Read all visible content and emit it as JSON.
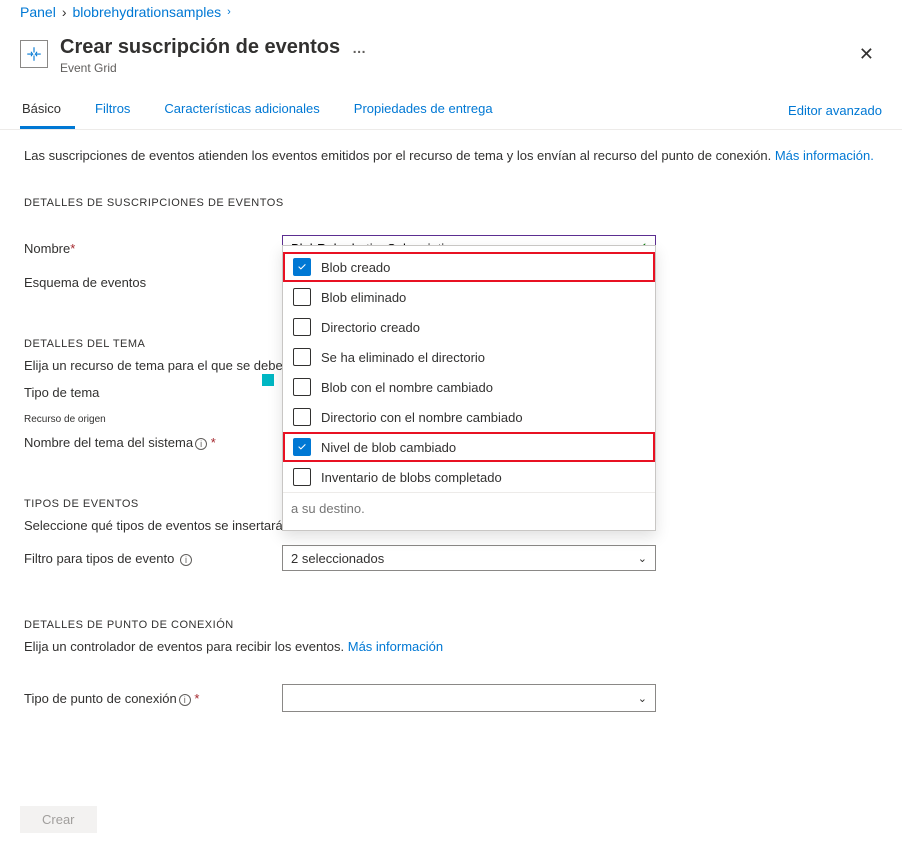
{
  "breadcrumb": {
    "panel": "Panel",
    "resource": "blobrehydrationsamples"
  },
  "header": {
    "title": "Crear suscripción de eventos",
    "subtitle": "Event Grid",
    "more": "…"
  },
  "tabs": {
    "items": [
      "Básico",
      "Filtros",
      "Características adicionales",
      "Propiedades de entrega"
    ],
    "activeIndex": 0,
    "right": "Editor avanzado"
  },
  "intro": {
    "text": "Las suscripciones de eventos atienden los eventos emitidos por el recurso de tema y los envían al recurso del punto de conexión. ",
    "moreLink": "Más información."
  },
  "sections": {
    "subscription": {
      "heading": "DETALLES DE SUSCRIPCIONES DE EVENTOS",
      "nameLabel": "Nombre",
      "nameValue": "BlobRehydrationSubscription",
      "schemaLabel": "Esquema de eventos"
    },
    "topic": {
      "heading": "DETALLES DEL TEMA",
      "sub": "Elija un recurso de tema para el que se deben",
      "typeLabel": "Tipo de tema",
      "sourceLabel": "Recurso de origen",
      "systemNameLabel": "Nombre del tema del sistema"
    },
    "eventTypes": {
      "heading": "TIPOS DE EVENTOS",
      "sub": "Seleccione qué tipos de eventos se insertarán a su destino.",
      "filterLabel": "Filtro para tipos de evento",
      "selectedSummary": "2 seleccionados",
      "options": [
        {
          "label": "Blob creado",
          "checked": true,
          "highlight": true
        },
        {
          "label": "Blob eliminado",
          "checked": false,
          "highlight": false
        },
        {
          "label": "Directorio creado",
          "checked": false,
          "highlight": false
        },
        {
          "label": "Se ha eliminado el directorio",
          "checked": false,
          "highlight": false
        },
        {
          "label": "Blob con el nombre cambiado",
          "checked": false,
          "highlight": false
        },
        {
          "label": "Directorio con el nombre cambiado",
          "checked": false,
          "highlight": false
        },
        {
          "label": "Nivel de blob cambiado",
          "checked": true,
          "highlight": true
        },
        {
          "label": "Inventario de blobs completado",
          "checked": false,
          "highlight": false
        }
      ],
      "searchPlaceholder": "a su destino."
    },
    "endpoint": {
      "heading": "DETALLES DE PUNTO DE CONEXIÓN",
      "sub": "Elija un controlador de eventos para recibir los eventos. ",
      "subLink": "Más información",
      "typeLabel": "Tipo de punto de conexión"
    }
  },
  "footer": {
    "create": "Crear"
  }
}
